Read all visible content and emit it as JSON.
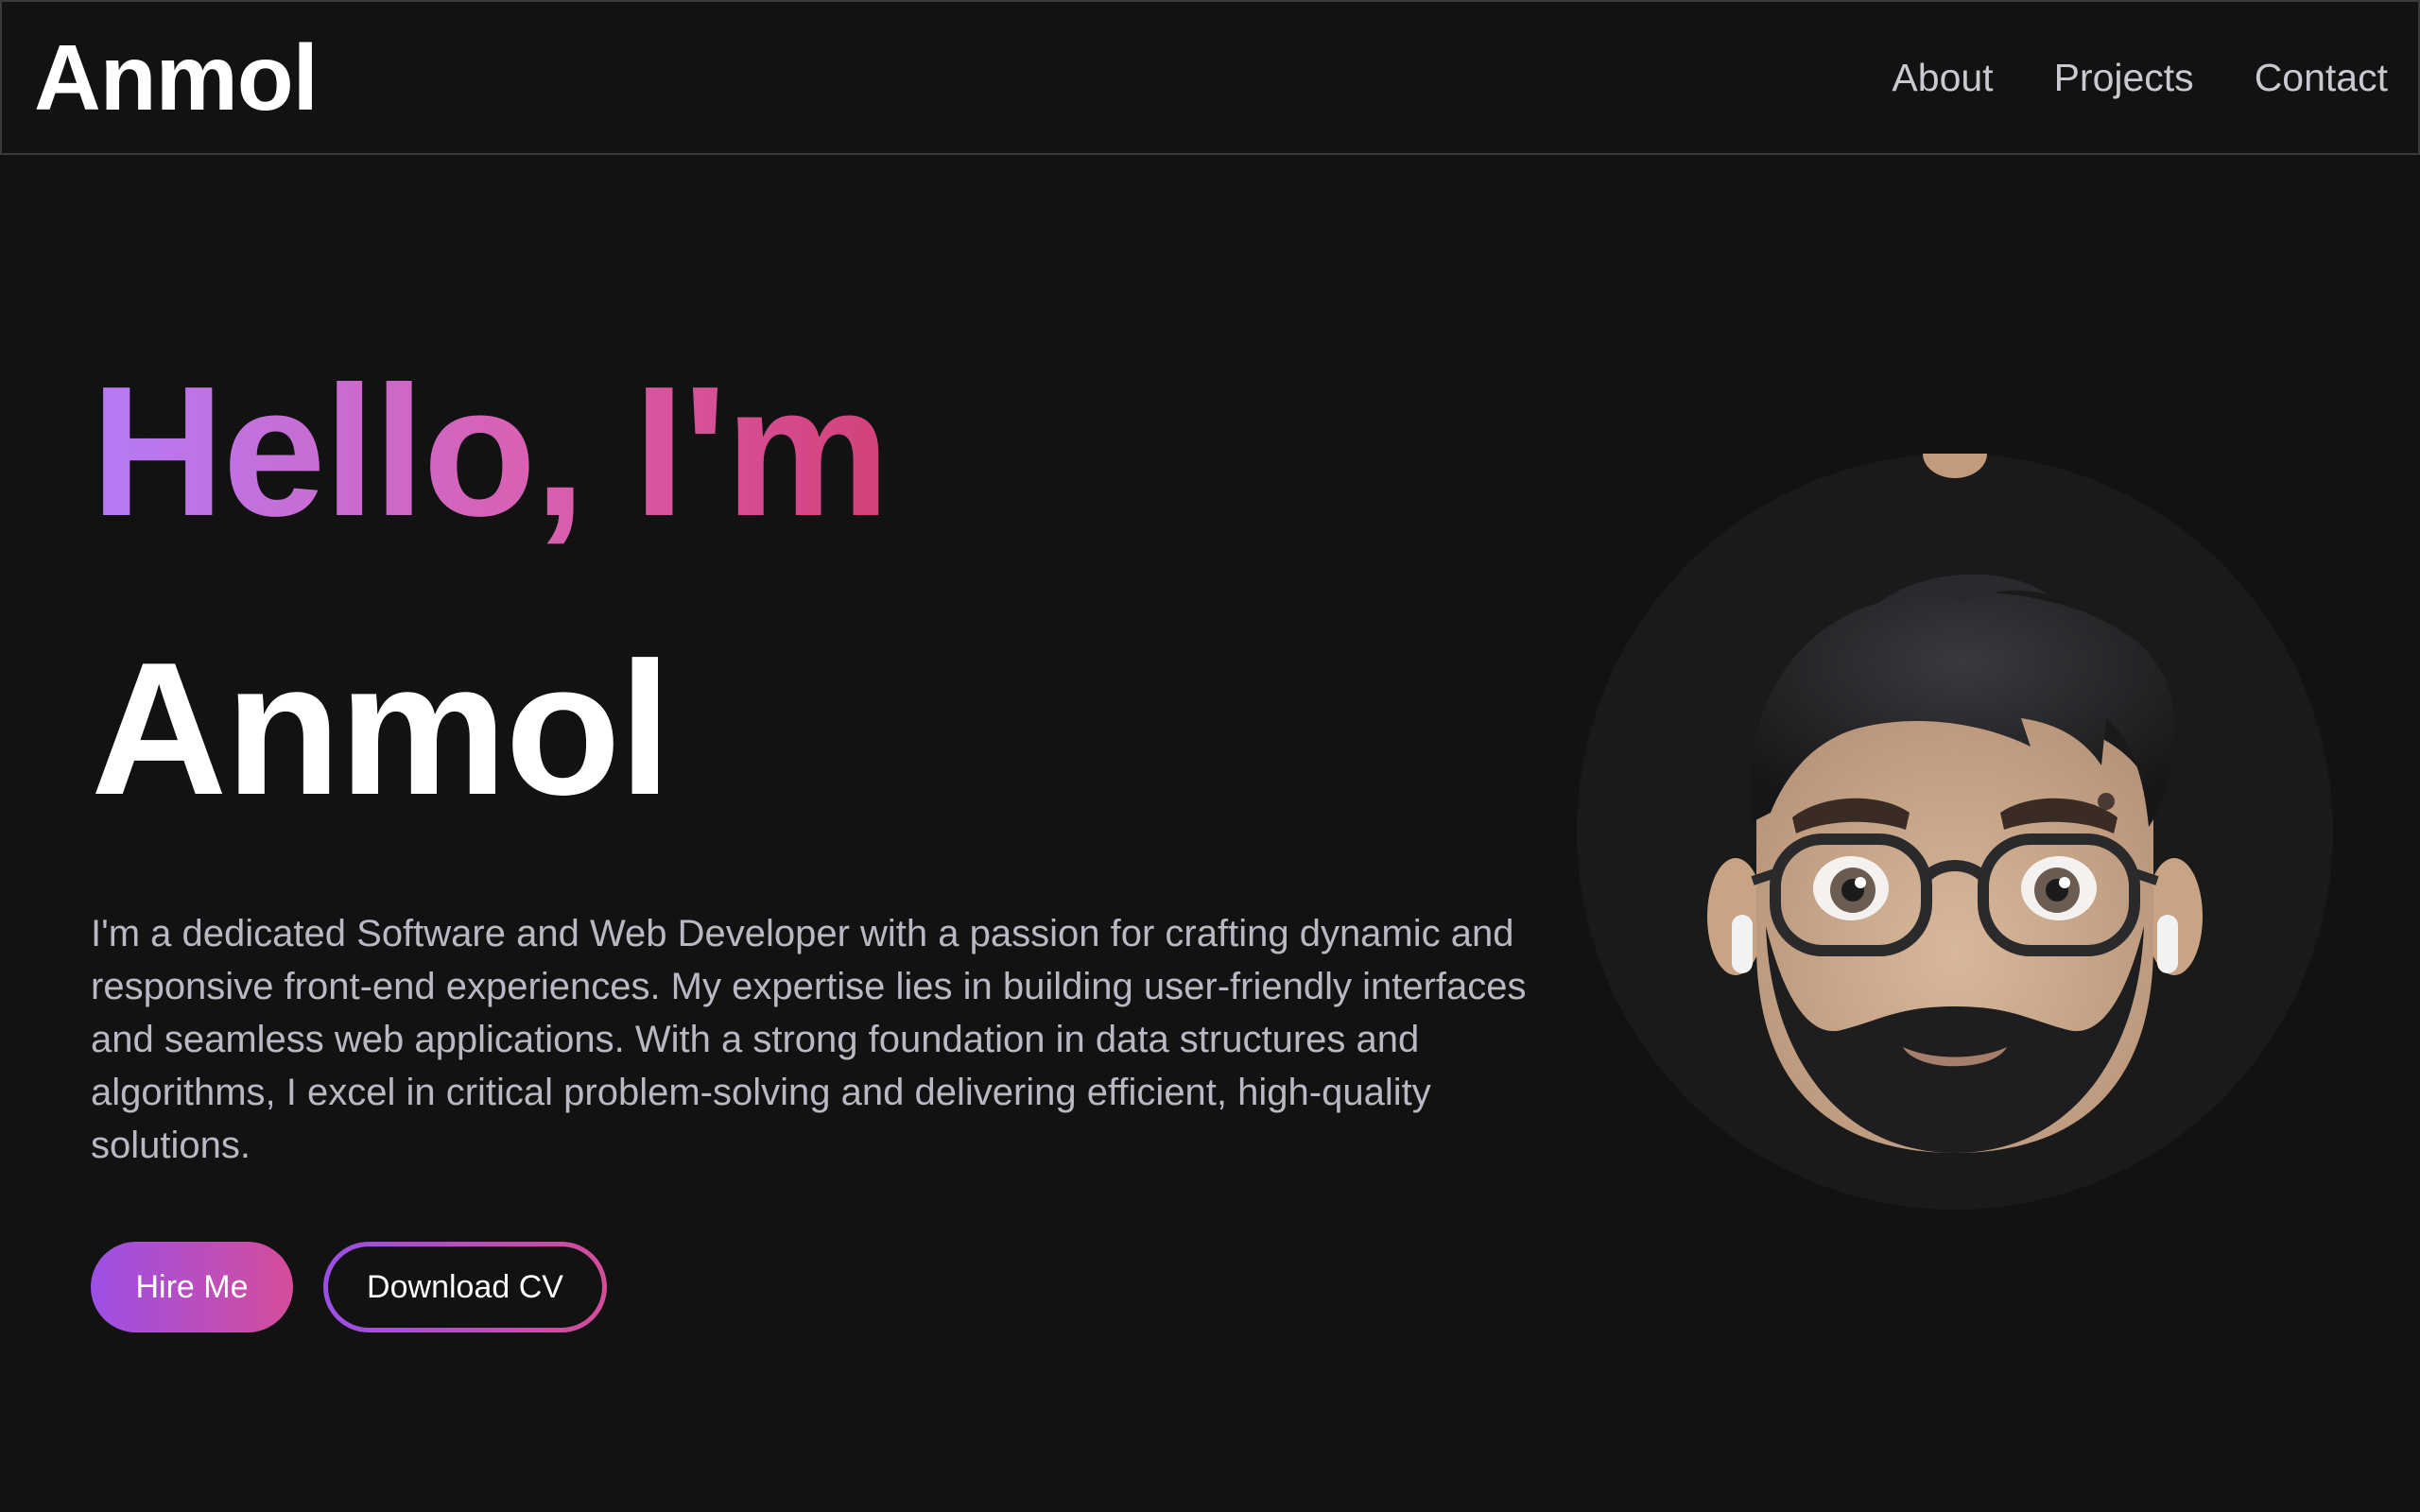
{
  "header": {
    "brand": "Anmol",
    "nav": [
      {
        "label": "About"
      },
      {
        "label": "Projects"
      },
      {
        "label": "Contact"
      }
    ]
  },
  "hero": {
    "greeting": "Hello, I'm",
    "name": "Anmol",
    "intro": "I'm a dedicated Software and Web Developer with a passion for crafting dynamic and responsive front-end experiences. My expertise lies in building user-friendly interfaces and seamless web applications. With a strong foundation in data structures and algorithms, I excel in critical problem-solving and delivering efficient, high-quality solutions.",
    "primary_button": "Hire Me",
    "secondary_button": "Download CV"
  },
  "avatar": {
    "icon": "memoji-avatar",
    "alt": "Anmol"
  },
  "colors": {
    "background": "#121212",
    "gradient_start": "#b57af6",
    "gradient_end": "#d2417a",
    "button_gradient_start": "#9c4fe6",
    "button_gradient_end": "#d44d9a",
    "body_text": "#b8b9c2",
    "nav_text": "#c9c9cf"
  }
}
